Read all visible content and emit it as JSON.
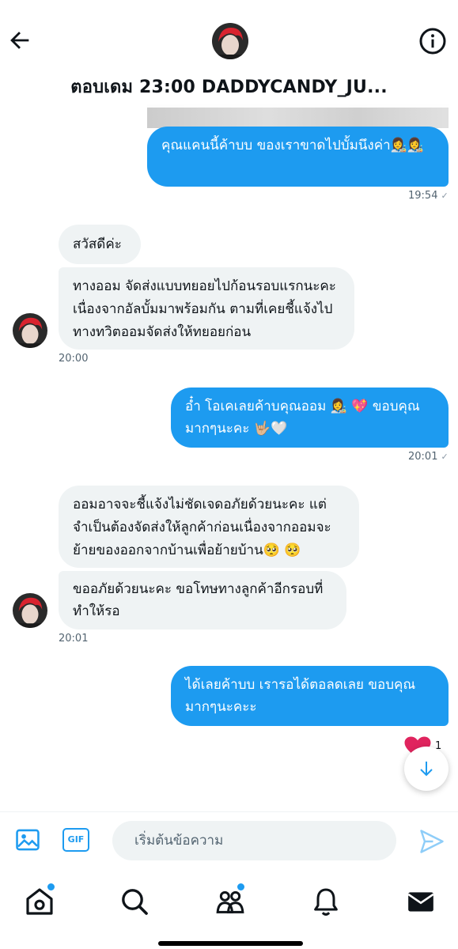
{
  "header": {
    "title": "ตอบเดม 23:00 DADDYCANDY_JU...",
    "back_icon": "arrow-left-icon",
    "info_icon": "info-icon"
  },
  "messages": [
    {
      "id": "m1",
      "dir": "out",
      "text": "คุณแคนนี้ค้าบบ ของเราขาดไปบั้มนึงค่า👩‍🎨👩‍🎨"
    },
    {
      "id": "t1",
      "time": "19:54",
      "check": "✓"
    },
    {
      "id": "m2",
      "dir": "in",
      "text": "สวัสดีค่ะ"
    },
    {
      "id": "m3",
      "dir": "in",
      "text": "ทางออม จัดส่งแบบทยอยไปก้อนรอบแรกนะคะ เนื่องจากอัลบั้มมาพร้อมกัน ตามที่เคยชี้แจ้งไปทางทวิตออมจัดส่งให้ทยอยก่อน"
    },
    {
      "id": "t2",
      "time": "20:00"
    },
    {
      "id": "m4",
      "dir": "out",
      "text": "อ๋ำ โอเคเลยค้าบคุณออม 👩‍🎨 💖 ขอบคุณมากๆนะคะ 🤟🏼🤍"
    },
    {
      "id": "t3",
      "time": "20:01",
      "check": "✓"
    },
    {
      "id": "m5",
      "dir": "in",
      "text": "ออมอาจจะชี้แจ้งไม่ชัดเจดอภัยด้วยนะคะ แต่จำเป็นต้องจัดส่งให้ลูกค้าก่อนเนื่องจากออมจะย้ายของออกจากบ้านเพื่อย้ายบ้าน🥺 🥺"
    },
    {
      "id": "m6",
      "dir": "in",
      "text": "ขออภัยด้วยนะคะ ขอโทษทางลูกค้าอีกรอบที่ทำให้รอ"
    },
    {
      "id": "t4",
      "time": "20:01"
    },
    {
      "id": "m7",
      "dir": "out",
      "text": "ได้เลยค้าบบ เรารอได้ตอลดเลย ขอบคุณมากๆนะคะะ"
    }
  ],
  "reaction": {
    "icon": "heart-icon",
    "count": "1",
    "color": "#f91880"
  },
  "scroll_down_icon": "arrow-down-icon",
  "composer": {
    "placeholder": "เริ่มต้นข้อความ",
    "media_icon": "image-icon",
    "gif_label": "GIF",
    "send_icon": "send-icon"
  },
  "nav": [
    {
      "icon": "home-icon",
      "badge": true
    },
    {
      "icon": "search-icon",
      "badge": false
    },
    {
      "icon": "communities-icon",
      "badge": true
    },
    {
      "icon": "bell-icon",
      "badge": false
    },
    {
      "icon": "mail-icon",
      "badge": false
    }
  ],
  "colors": {
    "accent": "#1d9bf0",
    "incoming_bg": "#eff3f4",
    "avatar_hair": "#d9232e"
  }
}
